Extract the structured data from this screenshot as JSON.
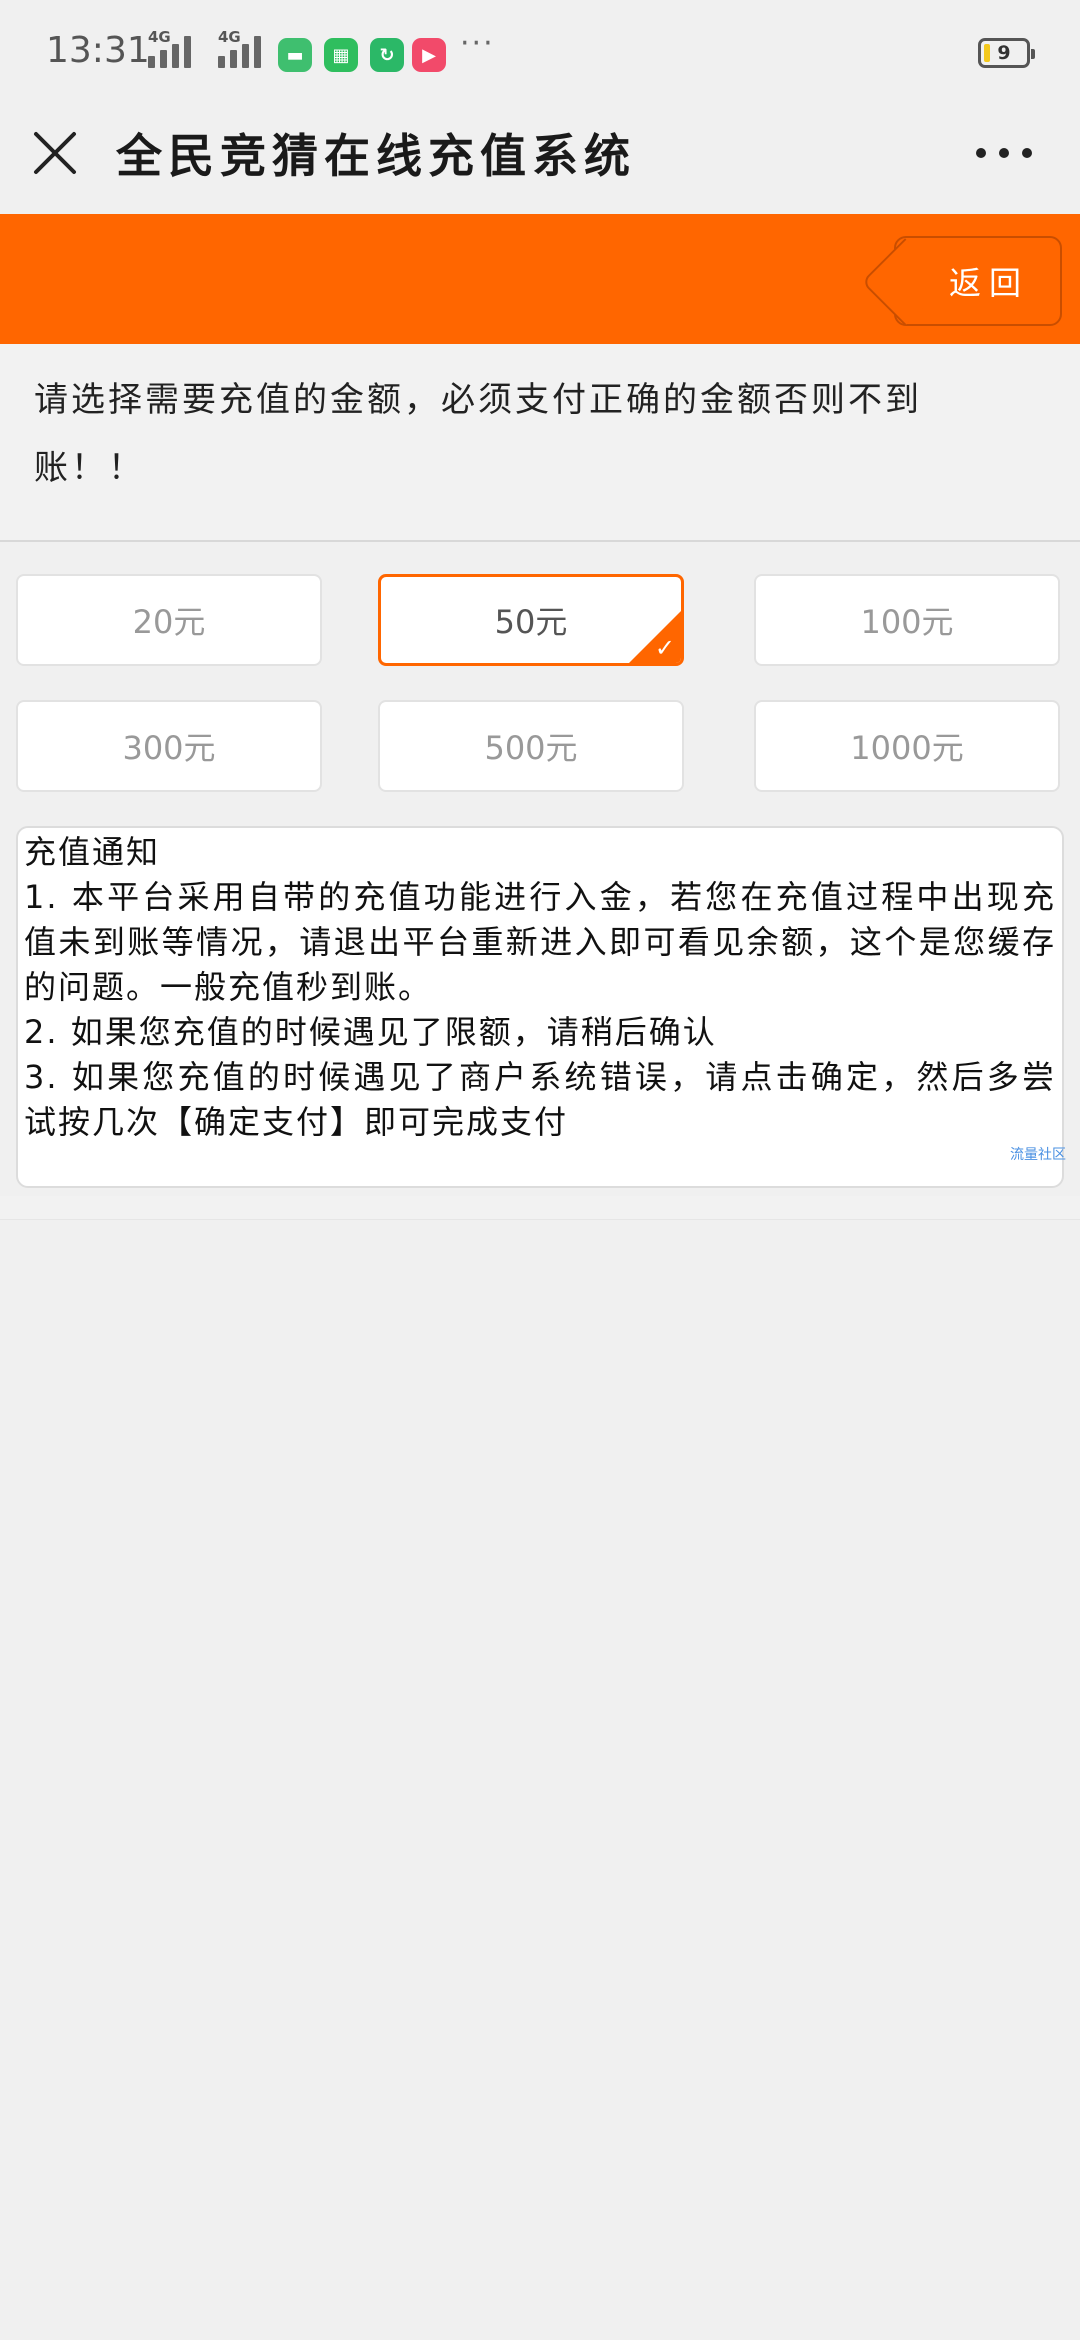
{
  "status_bar": {
    "time": "13:31",
    "network_1": "4G",
    "network_2": "4G",
    "overflow": "···",
    "battery_level": "9",
    "apps": [
      {
        "icon": "chat-bubble-icon",
        "color": "#3fbf6f"
      },
      {
        "icon": "qr-app-icon",
        "color": "#2fbe5e"
      },
      {
        "icon": "sync-app-icon",
        "color": "#2bb867"
      },
      {
        "icon": "play-app-icon",
        "color": "#f24a6a"
      }
    ]
  },
  "titlebar": {
    "title": "全民竞猜在线充值系统"
  },
  "header": {
    "back_label": "返回",
    "accent": "#ff6600"
  },
  "instruction": {
    "line1": "请选择需要充值的金额，必须支付正确的金额否则不到",
    "line2": "账！！"
  },
  "amounts": [
    {
      "label": "20元",
      "selected": false
    },
    {
      "label": "50元",
      "selected": true
    },
    {
      "label": "100元",
      "selected": false
    },
    {
      "label": "300元",
      "selected": false
    },
    {
      "label": "500元",
      "selected": false
    },
    {
      "label": "1000元",
      "selected": false
    }
  ],
  "notice": {
    "title": "充值通知",
    "item1": "1. 本平台采用自带的充值功能进行入金，若您在充值过程中出现充值未到账等情况，请退出平台重新进入即可看见余额，这个是您缓存的问题。一般充值秒到账。",
    "item2": "2. 如果您充值的时候遇见了限额，请稍后确认",
    "item3": "3. 如果您充值的时候遇见了商户系统错误，请点击确定，然后多尝试按几次【确定支付】即可完成支付",
    "watermark": "流量社区"
  }
}
